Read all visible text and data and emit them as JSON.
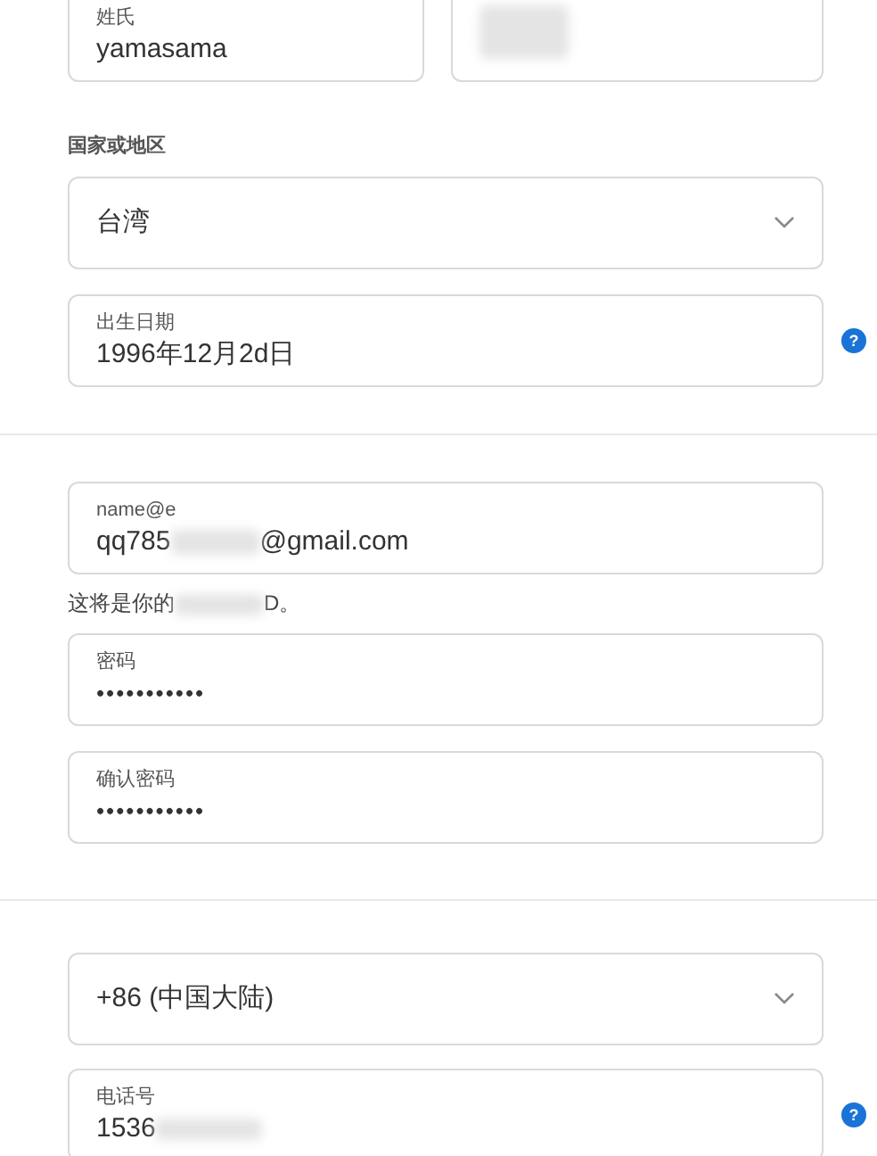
{
  "name_row": {
    "last_name": {
      "label": "姓氏",
      "value": "yamasama"
    },
    "first_name": {
      "redacted": true
    }
  },
  "region": {
    "label": "国家或地区",
    "value": "台湾"
  },
  "birthday": {
    "label": "出生日期",
    "value": "1996年12月2d日",
    "help": "?"
  },
  "account": {
    "email": {
      "label": "name@e",
      "value_start": "qq785",
      "value_end": "@gmail.com"
    },
    "note_start": "这将是你的",
    "note_end": "D。",
    "password": {
      "label": "密码",
      "value": "•••••••••••"
    },
    "confirm_password": {
      "label": "确认密码",
      "value": "•••••••••••"
    }
  },
  "phone": {
    "country": {
      "value": "+86 (中国大陆)"
    },
    "number": {
      "label": "电话号",
      "value": "1536",
      "help": "?"
    }
  }
}
